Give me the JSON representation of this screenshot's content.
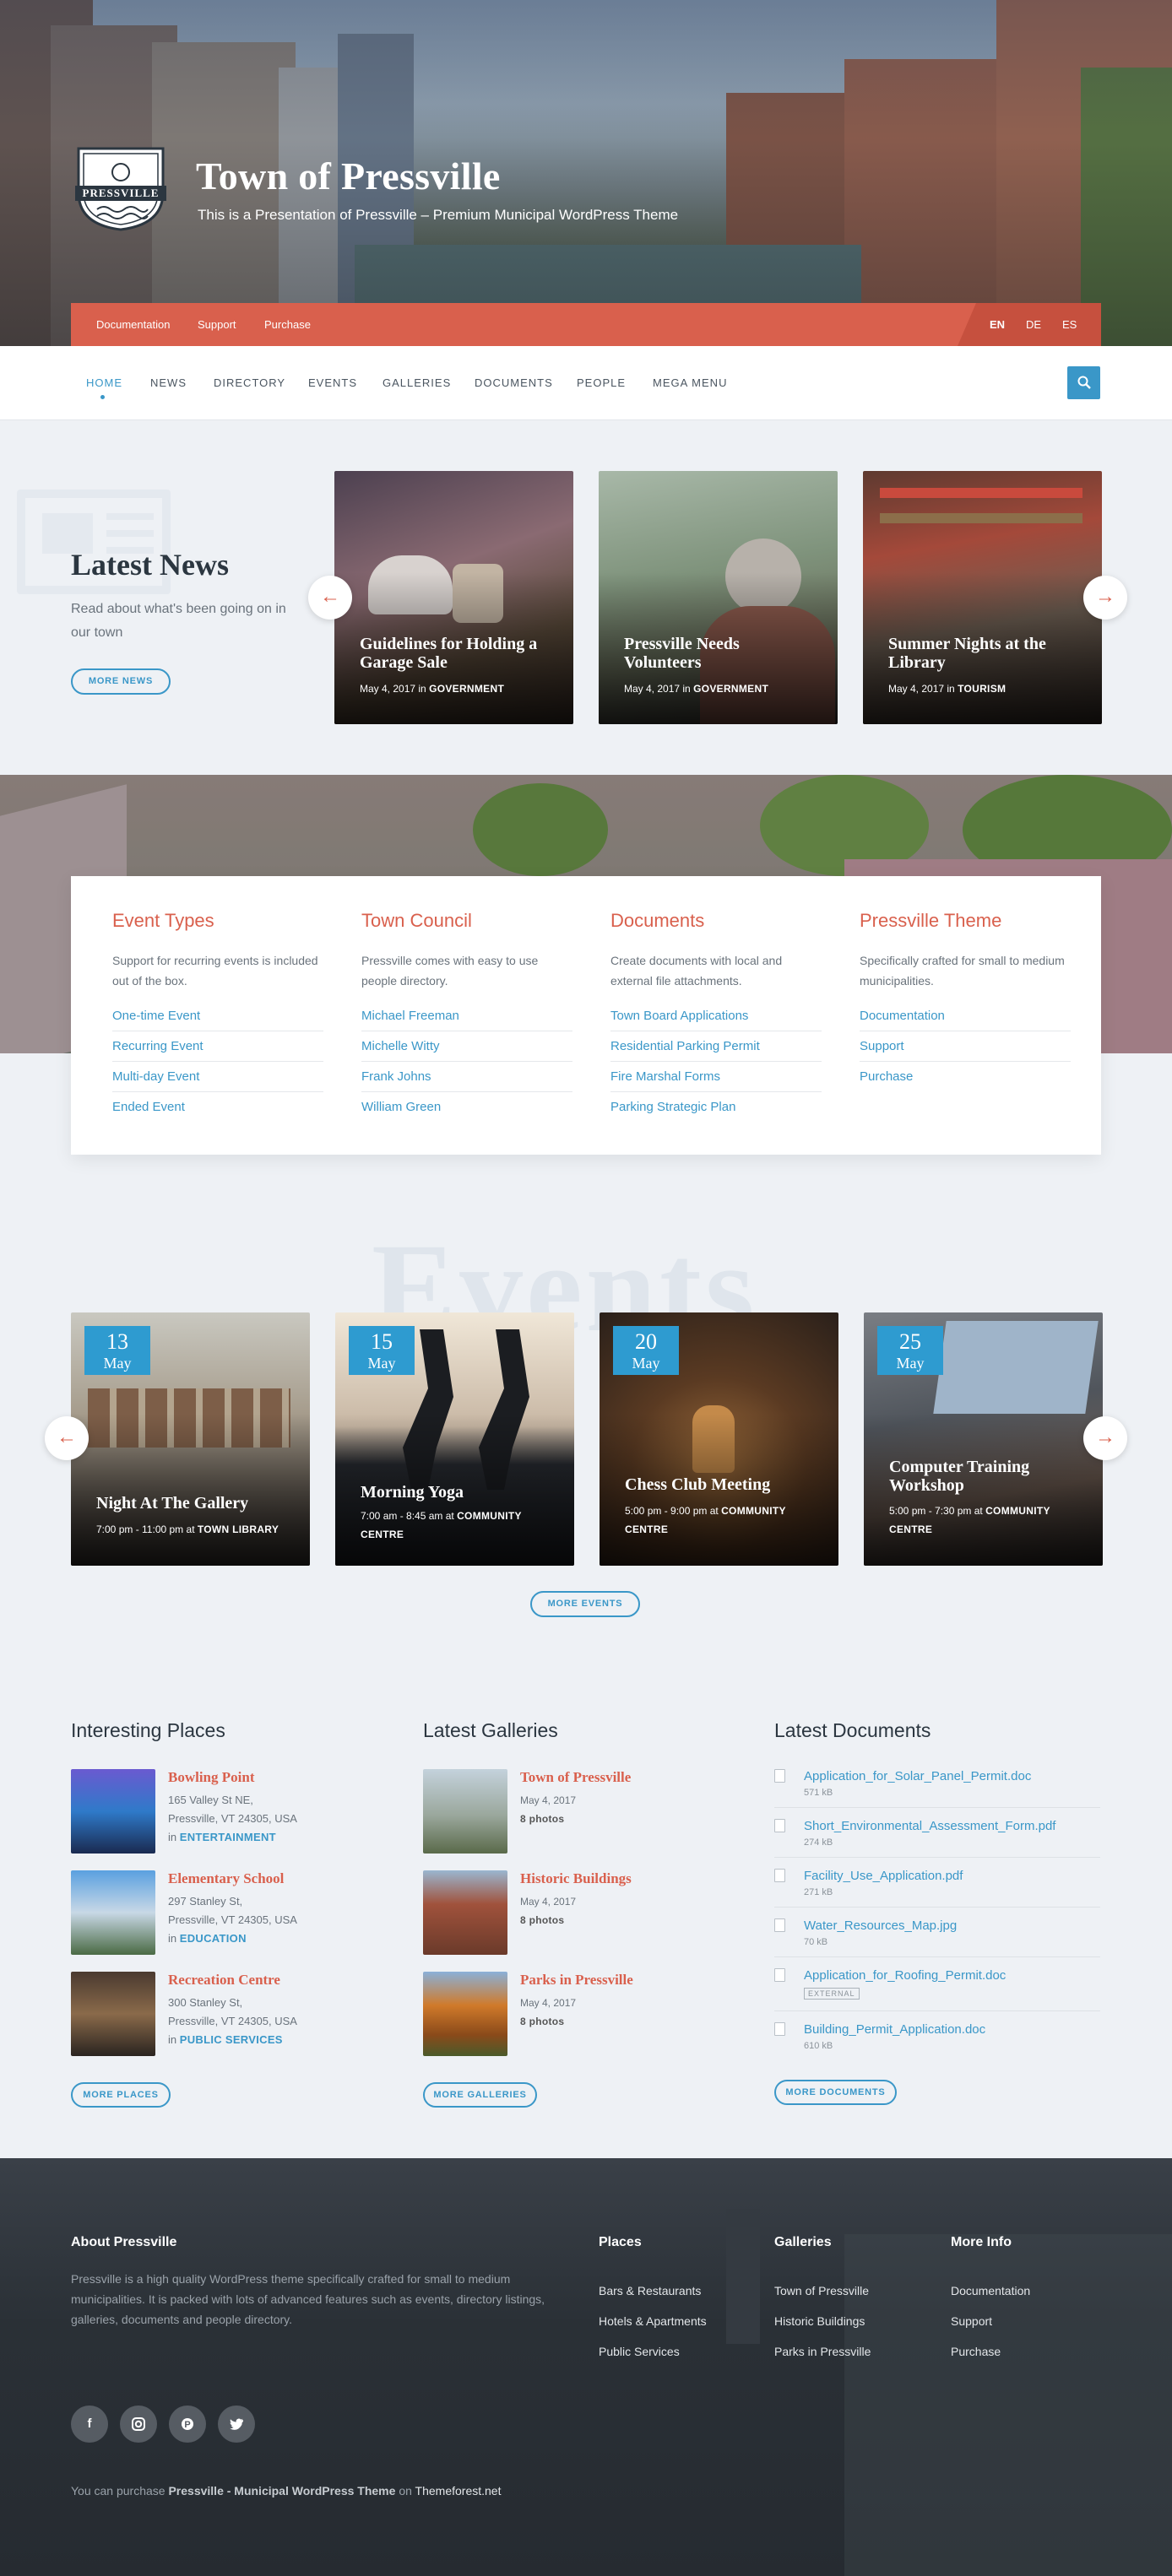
{
  "site": {
    "title": "Town of Pressville",
    "tagline": "This is a Presentation of Pressville – Premium Municipal WordPress Theme",
    "logo_text": "PRESSVILLE"
  },
  "topbar": {
    "links": [
      "Documentation",
      "Support",
      "Purchase"
    ],
    "languages": [
      "EN",
      "DE",
      "ES"
    ]
  },
  "nav": {
    "items": [
      "HOME",
      "NEWS",
      "DIRECTORY",
      "EVENTS",
      "GALLERIES",
      "DOCUMENTS",
      "PEOPLE",
      "MEGA MENU"
    ],
    "active": "HOME"
  },
  "news": {
    "title": "Latest News",
    "description": "Read about what's been going on in our town",
    "button": "MORE NEWS",
    "cards": [
      {
        "title": "Guidelines for Holding a Garage Sale",
        "date": "May 4, 2017",
        "in": "in",
        "category": "GOVERNMENT"
      },
      {
        "title": "Pressville Needs Volunteers",
        "date": "May 4, 2017",
        "in": "in",
        "category": "GOVERNMENT"
      },
      {
        "title": "Summer Nights at the Library",
        "date": "May 4, 2017",
        "in": "in",
        "category": "TOURISM"
      }
    ]
  },
  "features": [
    {
      "title": "Event Types",
      "text": "Support for recurring events is included out of the box.",
      "links": [
        "One-time Event",
        "Recurring Event",
        "Multi-day Event",
        "Ended Event"
      ]
    },
    {
      "title": "Town Council",
      "text": "Pressville comes with easy to use people directory.",
      "links": [
        "Michael Freeman",
        "Michelle Witty",
        "Frank Johns",
        "William Green"
      ]
    },
    {
      "title": "Documents",
      "text": "Create documents with local and external file attachments.",
      "links": [
        "Town Board Applications",
        "Residential Parking Permit",
        "Fire Marshal Forms",
        "Parking Strategic Plan"
      ]
    },
    {
      "title": "Pressville Theme",
      "text": "Specifically crafted for small to medium municipalities.",
      "links": [
        "Documentation",
        "Support",
        "Purchase"
      ]
    }
  ],
  "events": {
    "bg_word": "Events",
    "button": "MORE EVENTS",
    "cards": [
      {
        "day": "13",
        "month": "May",
        "title": "Night At The Gallery",
        "time": "7:00 pm - 11:00 pm",
        "at": "at",
        "venue": "TOWN LIBRARY"
      },
      {
        "day": "15",
        "month": "May",
        "title": "Morning Yoga",
        "time": "7:00 am - 8:45 am",
        "at": "at",
        "venue": "COMMUNITY CENTRE"
      },
      {
        "day": "20",
        "month": "May",
        "title": "Chess Club Meeting",
        "time": "5:00 pm - 9:00 pm",
        "at": "at",
        "venue": "COMMUNITY CENTRE"
      },
      {
        "day": "25",
        "month": "May",
        "title": "Computer Training Workshop",
        "time": "5:00 pm - 7:30 pm",
        "at": "at",
        "venue": "COMMUNITY CENTRE"
      }
    ]
  },
  "places": {
    "title": "Interesting Places",
    "button": "MORE PLACES",
    "items": [
      {
        "name": "Bowling Point",
        "addr1": "165 Valley St NE,",
        "addr2": "Pressville, VT 24305, USA",
        "in": "in",
        "category": "ENTERTAINMENT"
      },
      {
        "name": "Elementary School",
        "addr1": "297 Stanley St,",
        "addr2": "Pressville, VT 24305, USA",
        "in": "in",
        "category": "EDUCATION"
      },
      {
        "name": "Recreation Centre",
        "addr1": "300 Stanley St,",
        "addr2": "Pressville, VT 24305, USA",
        "in": "in",
        "category": "PUBLIC SERVICES"
      }
    ]
  },
  "galleries": {
    "title": "Latest Galleries",
    "button": "MORE GALLERIES",
    "items": [
      {
        "name": "Town of Pressville",
        "date": "May 4, 2017",
        "count": "8 photos"
      },
      {
        "name": "Historic Buildings",
        "date": "May 4, 2017",
        "count": "8 photos"
      },
      {
        "name": "Parks in Pressville",
        "date": "May 4, 2017",
        "count": "8 photos"
      }
    ]
  },
  "documents": {
    "title": "Latest Documents",
    "button": "MORE DOCUMENTS",
    "items": [
      {
        "name": "Application_for_Solar_Panel_Permit.doc",
        "size": "571 kB"
      },
      {
        "name": "Short_Environmental_Assessment_Form.pdf",
        "size": "274 kB"
      },
      {
        "name": "Facility_Use_Application.pdf",
        "size": "271 kB"
      },
      {
        "name": "Water_Resources_Map.jpg",
        "size": "70 kB"
      },
      {
        "name": "Application_for_Roofing_Permit.doc",
        "size": "EXTERNAL"
      },
      {
        "name": "Building_Permit_Application.doc",
        "size": "610 kB"
      }
    ]
  },
  "footer": {
    "about_title": "About Pressville",
    "about_text": "Pressville is a high quality WordPress theme specifically crafted for small to medium municipalities. It is packed with lots of advanced features such as events, directory listings, galleries, documents and people directory.",
    "places": {
      "title": "Places",
      "links": [
        "Bars & Restaurants",
        "Hotels & Apartments",
        "Public Services"
      ]
    },
    "galleries": {
      "title": "Galleries",
      "links": [
        "Town of Pressville",
        "Historic Buildings",
        "Parks in Pressville"
      ]
    },
    "more": {
      "title": "More Info",
      "links": [
        "Documentation",
        "Support",
        "Purchase"
      ]
    },
    "social": [
      "facebook-icon",
      "instagram-icon",
      "pinterest-icon",
      "twitter-icon"
    ],
    "copy_prefix": "You can purchase",
    "copy_product": "Pressville - Municipal WordPress Theme",
    "copy_mid": "on",
    "copy_site": "Themeforest.net"
  },
  "colors": {
    "accent": "#3a97c8",
    "brand_red": "#d9604d",
    "footer_bg": "#2d333a"
  }
}
